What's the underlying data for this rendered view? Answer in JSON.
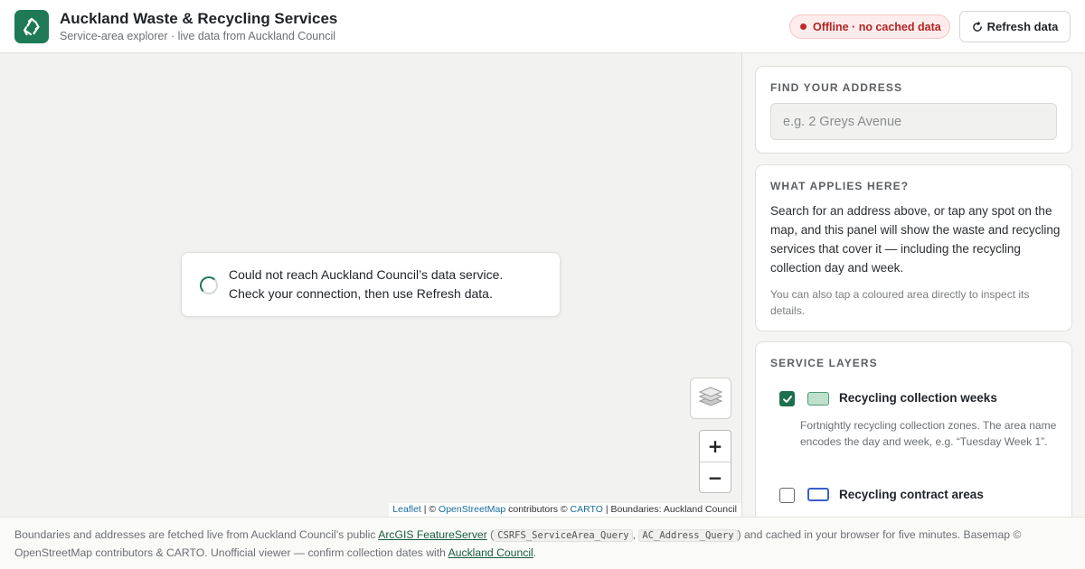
{
  "header": {
    "logo_icon": "recycle-icon",
    "title": "Auckland Waste & Recycling Services",
    "subtitle": "Service-area explorer · live data from Auckland Council",
    "status": "Offline · no cached data",
    "refresh_label": "Refresh data"
  },
  "colors": {
    "brand": "#1d7a55",
    "offline": "#b42323",
    "link": "#1a6fa0"
  },
  "map": {
    "error_line1": "Could not reach Auckland Council’s data service.",
    "error_line2": "Check your connection, then use Refresh data.",
    "layers_icon": "layers-icon",
    "zoom_in": "+",
    "zoom_out": "−",
    "attribution": {
      "leaflet": "Leaflet",
      "sep1": " | © ",
      "osm": "OpenStreetMap",
      "mid": " contributors © ",
      "carto": "CARTO",
      "tail": " | Boundaries: Auckland Council"
    }
  },
  "sidebar": {
    "find": {
      "title": "FIND YOUR ADDRESS",
      "placeholder": "e.g. 2 Greys Avenue"
    },
    "what": {
      "title": "WHAT APPLIES HERE?",
      "body": "Search for an address above, or tap any spot on the map, and this panel will show the waste and recycling services that cover it — including the recycling collection day and week.",
      "note": "You can also tap a coloured area directly to inspect its details."
    },
    "layers": {
      "title": "SERVICE LAYERS",
      "items": [
        {
          "label": "Recycling collection weeks",
          "checked": true,
          "description": "Fortnightly recycling collection zones. The area name encodes the day and week, e.g. “Tuesday Week 1”."
        },
        {
          "label": "Recycling contract areas",
          "checked": false
        }
      ]
    }
  },
  "footer": {
    "t1": "Boundaries and addresses are fetched live from Auckland Council’s public ",
    "link1": "ArcGIS FeatureServer",
    "t2": " (",
    "code1": "CSRFS_ServiceArea_Query",
    "t3": ", ",
    "code2": "AC_Address_Query",
    "t4": ") and cached in your browser for five minutes. Basemap © OpenStreetMap contributors & CARTO. Unofficial viewer — confirm collection dates with ",
    "link2": "Auckland Council",
    "t5": "."
  }
}
